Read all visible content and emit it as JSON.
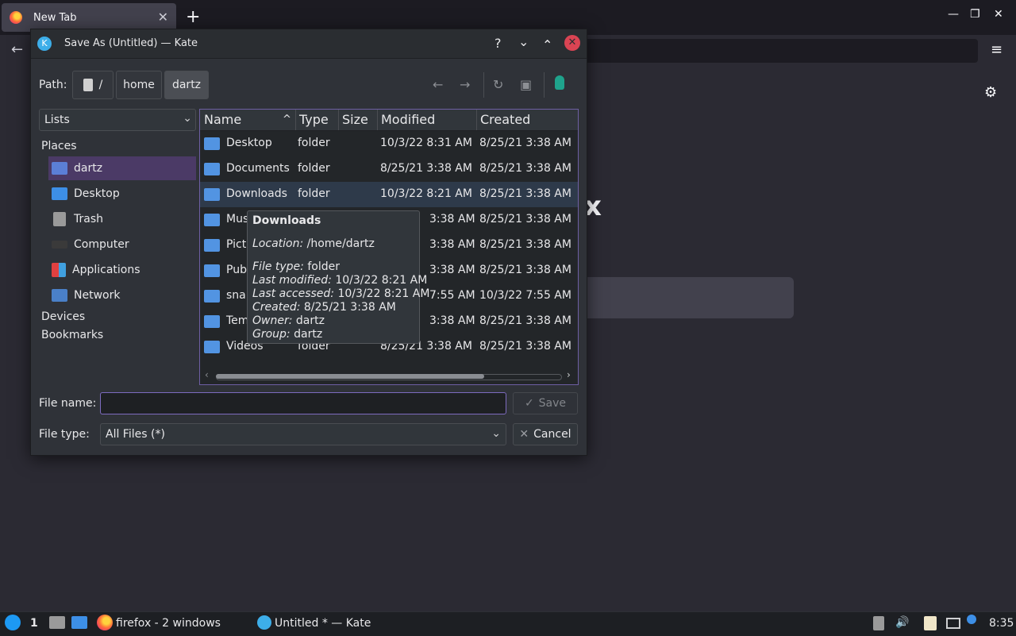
{
  "browser": {
    "tab_title": "New Tab",
    "tab_close": "✕",
    "new_tab": "+",
    "window_controls": {
      "minimize": "—",
      "maximize": "❐",
      "close": "✕"
    },
    "back_icon": "←",
    "menu_icon": "≡",
    "settings_icon": "⚙",
    "logo_fragment": "x"
  },
  "dialog": {
    "title": "Save As (Untitled) — Kate",
    "title_buttons": {
      "help": "?",
      "minimize": "⌄",
      "maximize": "⌃",
      "close": "✕"
    },
    "path_label": "Path:",
    "breadcrumbs": [
      "/",
      "home",
      "dartz"
    ],
    "nav_icons": {
      "back": "←",
      "forward": "→",
      "reload": "↻",
      "new_folder": "▣"
    },
    "lists_combo": "Lists",
    "places_header": "Places",
    "places": [
      {
        "label": "dartz",
        "icon": "home-folder-icon",
        "color": "#5b7fd6"
      },
      {
        "label": "Desktop",
        "icon": "desktop-icon",
        "color": "#3d8fe6"
      },
      {
        "label": "Trash",
        "icon": "trash-icon",
        "color": "#9a9a9a"
      },
      {
        "label": "Computer",
        "icon": "computer-icon",
        "color": "#3a3a3a"
      },
      {
        "label": "Applications",
        "icon": "applications-icon",
        "color": "#e0a030"
      },
      {
        "label": "Network",
        "icon": "network-folder-icon",
        "color": "#4a80c8"
      }
    ],
    "devices_header": "Devices",
    "bookmarks_header": "Bookmarks",
    "columns": [
      "Name",
      "Type",
      "Size",
      "Modified",
      "Created"
    ],
    "rows": [
      {
        "name": "Desktop",
        "type": "folder",
        "size": "",
        "modified": "10/3/22 8:31 AM",
        "created": "8/25/21 3:38 AM"
      },
      {
        "name": "Documents",
        "type": "folder",
        "size": "",
        "modified": "8/25/21 3:38 AM",
        "created": "8/25/21 3:38 AM"
      },
      {
        "name": "Downloads",
        "type": "folder",
        "size": "",
        "modified": "10/3/22 8:21 AM",
        "created": "8/25/21 3:38 AM"
      },
      {
        "name": "Mus",
        "type": "",
        "size": "",
        "modified": "3:38 AM",
        "created": "8/25/21 3:38 AM"
      },
      {
        "name": "Pict",
        "type": "",
        "size": "",
        "modified": "3:38 AM",
        "created": "8/25/21 3:38 AM"
      },
      {
        "name": "Pub",
        "type": "",
        "size": "",
        "modified": "3:38 AM",
        "created": "8/25/21 3:38 AM"
      },
      {
        "name": "snap",
        "type": "",
        "size": "",
        "modified": "7:55 AM",
        "created": "10/3/22 7:55 AM"
      },
      {
        "name": "Tem",
        "type": "",
        "size": "",
        "modified": "3:38 AM",
        "created": "8/25/21 3:38 AM"
      },
      {
        "name": "Videos",
        "type": "folder",
        "size": "",
        "modified": "8/25/21 3:38 AM",
        "created": "8/25/21 3:38 AM"
      }
    ],
    "tooltip": {
      "title": "Downloads",
      "location_label": "Location:",
      "location": "/home/dartz",
      "filetype_label": "File type:",
      "filetype": "folder",
      "modified_label": "Last modified:",
      "modified": "10/3/22 8:21 AM",
      "accessed_label": "Last accessed:",
      "accessed": "10/3/22 8:21 AM",
      "created_label": "Created:",
      "created": "8/25/21 3:38 AM",
      "owner_label": "Owner:",
      "owner": "dartz",
      "group_label": "Group:",
      "group": "dartz"
    },
    "filename_label": "File name:",
    "filename_value": "",
    "save_label": "Save",
    "filetype_label": "File type:",
    "filetype_value": "All Files (*)",
    "cancel_label": "Cancel"
  },
  "taskbar": {
    "desktop_number": "1",
    "firefox_label": "firefox - 2 windows",
    "kate_label": "Untitled * — Kate",
    "clock": "8:35"
  },
  "colors": {
    "accent": "#7d6bbf",
    "close": "#da4453",
    "folder": "#5294e2"
  }
}
